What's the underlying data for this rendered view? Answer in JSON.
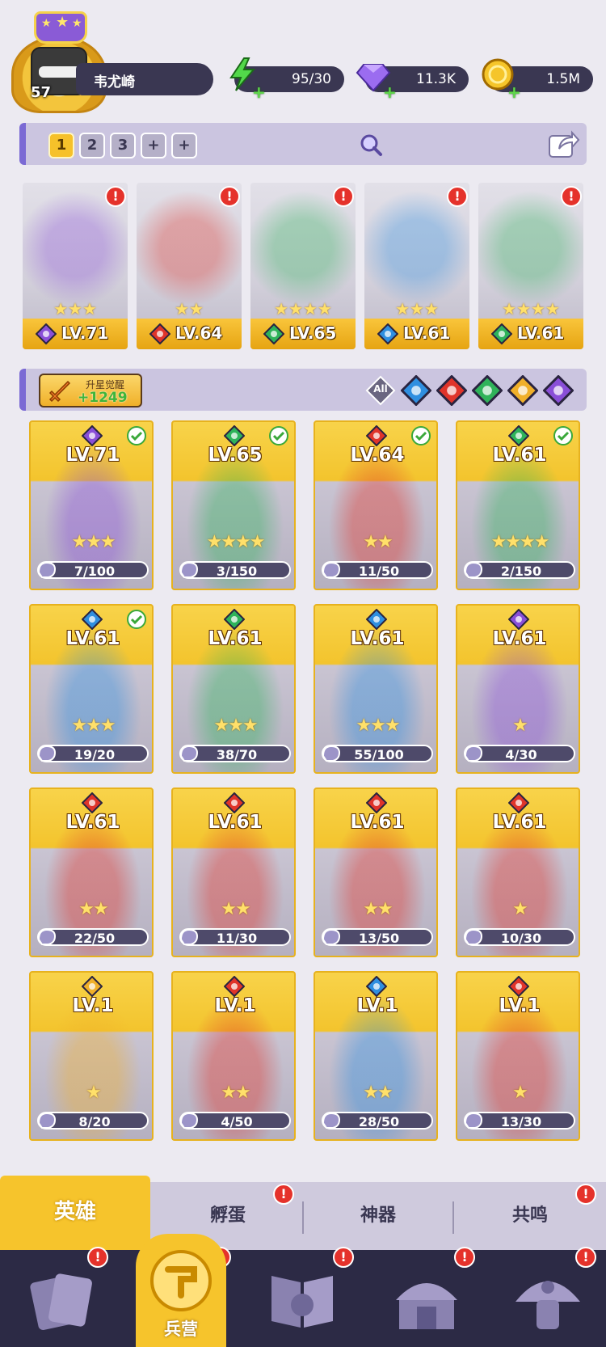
{
  "player": {
    "level": "57",
    "name": "韦尤崎"
  },
  "resources": {
    "energy": "95/30",
    "gems": "11.3K",
    "gold": "1.5M"
  },
  "team_tabs": [
    "1",
    "2",
    "3",
    "+",
    "+"
  ],
  "team": [
    {
      "level": "LV.71",
      "stars": "★★★",
      "element": "dark",
      "alert": "!"
    },
    {
      "level": "LV.64",
      "stars": "★★",
      "element": "fire",
      "alert": "!"
    },
    {
      "level": "LV.65",
      "stars": "★★★★",
      "element": "wind",
      "alert": "!"
    },
    {
      "level": "LV.61",
      "stars": "★★★",
      "element": "water",
      "alert": "!"
    },
    {
      "level": "LV.61",
      "stars": "★★★★",
      "element": "wind",
      "alert": "!"
    }
  ],
  "awaken": {
    "label": "升星觉醒",
    "value": "+1249"
  },
  "filters": [
    "All",
    "water",
    "fire",
    "wind",
    "light",
    "dark"
  ],
  "filter_all_label": "All",
  "heroes": [
    {
      "level": "LV.71",
      "stars": "★★★",
      "element": "dark",
      "fragments": "7/100",
      "checked": true
    },
    {
      "level": "LV.65",
      "stars": "★★★★",
      "element": "wind",
      "fragments": "3/150",
      "checked": true
    },
    {
      "level": "LV.64",
      "stars": "★★",
      "element": "fire",
      "fragments": "11/50",
      "checked": true
    },
    {
      "level": "LV.61",
      "stars": "★★★★",
      "element": "wind",
      "fragments": "2/150",
      "checked": true
    },
    {
      "level": "LV.61",
      "stars": "★★★",
      "element": "water",
      "fragments": "19/20",
      "checked": true
    },
    {
      "level": "LV.61",
      "stars": "★★★",
      "element": "wind",
      "fragments": "38/70",
      "checked": false
    },
    {
      "level": "LV.61",
      "stars": "★★★",
      "element": "water",
      "fragments": "55/100",
      "checked": false
    },
    {
      "level": "LV.61",
      "stars": "★",
      "element": "dark",
      "fragments": "4/30",
      "checked": false
    },
    {
      "level": "LV.61",
      "stars": "★★",
      "element": "fire",
      "fragments": "22/50",
      "checked": false
    },
    {
      "level": "LV.61",
      "stars": "★★",
      "element": "fire",
      "fragments": "11/30",
      "checked": false
    },
    {
      "level": "LV.61",
      "stars": "★★",
      "element": "fire",
      "fragments": "13/50",
      "checked": false
    },
    {
      "level": "LV.61",
      "stars": "★",
      "element": "fire",
      "fragments": "10/30",
      "checked": false
    },
    {
      "level": "LV.1",
      "stars": "★",
      "element": "light",
      "fragments": "8/20",
      "checked": false
    },
    {
      "level": "LV.1",
      "stars": "★★",
      "element": "fire",
      "fragments": "4/50",
      "checked": false
    },
    {
      "level": "LV.1",
      "stars": "★★",
      "element": "water",
      "fragments": "28/50",
      "checked": false
    },
    {
      "level": "LV.1",
      "stars": "★",
      "element": "fire",
      "fragments": "13/30",
      "checked": false
    }
  ],
  "sub_tabs": [
    {
      "label": "英雄",
      "active": true,
      "alert": false
    },
    {
      "label": "孵蛋",
      "active": false,
      "alert": true
    },
    {
      "label": "神器",
      "active": false,
      "alert": false
    },
    {
      "label": "共鸣",
      "active": false,
      "alert": true
    }
  ],
  "nav": [
    {
      "icon": "cards-icon",
      "label": "",
      "alert": true
    },
    {
      "icon": "barracks-icon",
      "label": "兵营",
      "alert": true,
      "active": true
    },
    {
      "icon": "map-book-icon",
      "label": "",
      "alert": true
    },
    {
      "icon": "temple-icon",
      "label": "",
      "alert": true
    },
    {
      "icon": "mushroom-icon",
      "label": "",
      "alert": true
    }
  ],
  "colors": {
    "gold": "#f6c42c",
    "panel": "#cbc5e0",
    "nav": "#2c2a45",
    "alert": "#e5322b",
    "fire": "#e0342a",
    "water": "#2f8fe0",
    "wind": "#2fb35a",
    "light": "#f0b02a",
    "dark": "#8a4fd8"
  }
}
